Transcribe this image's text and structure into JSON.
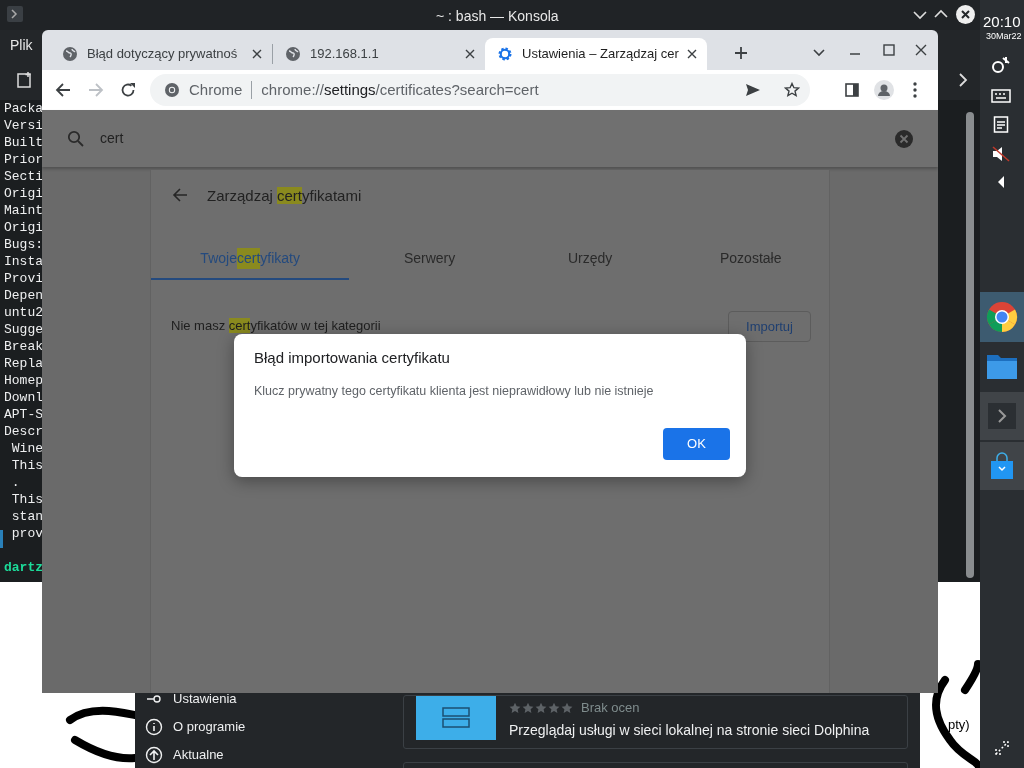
{
  "konsole": {
    "title": "~ : bash — Konsola",
    "menu": [
      "Plik"
    ],
    "terminal_lines": [
      "Packa",
      "Versi",
      "Built",
      "Prior",
      "Secti",
      "Origi",
      "Maint",
      "Origi",
      "Bugs:",
      "Insta",
      "Provi",
      "Depen",
      "untu2",
      "Sugge",
      "Break",
      "Repla",
      "Homep",
      "Downl",
      "APT-S",
      "Descr",
      " Wine",
      " This",
      " .",
      " This",
      " stan",
      " prov"
    ],
    "prompt": "dartz"
  },
  "panel": {
    "time": "20:10",
    "date": "30Mar22"
  },
  "discover": {
    "sidebar": [
      {
        "label": "Ustawienia"
      },
      {
        "label": "O programie"
      },
      {
        "label": "Aktualne"
      }
    ],
    "card": {
      "stars": 0,
      "rating_text": "Brak ocen",
      "description": "Przeglądaj usługi w sieci lokalnej na stronie sieci Dolphina"
    }
  },
  "desktop_text": "pty)",
  "browser": {
    "tabs": [
      {
        "title": "Błąd dotyczący prywatnoś",
        "selected": false
      },
      {
        "title": "192.168.1.1",
        "selected": false
      },
      {
        "title": "Ustawienia – Zarządzaj cer",
        "selected": true
      }
    ],
    "omnibox": {
      "chip": "Chrome",
      "url_parts": [
        {
          "text": "chrome://",
          "emphasized": false
        },
        {
          "text": "settings",
          "emphasized": true
        },
        {
          "text": "/certificates?search=cert",
          "emphasized": false
        }
      ]
    },
    "forward_disabled": true
  },
  "settings": {
    "search": "cert",
    "heading": [
      {
        "text": "Zarządzaj ",
        "highlighted": false
      },
      {
        "text": "cert",
        "highlighted": true
      },
      {
        "text": "yfikatami",
        "highlighted": false
      }
    ],
    "tabs": [
      {
        "parts": [
          {
            "text": "Twoje ",
            "highlighted": false
          },
          {
            "text": "cert",
            "highlighted": true
          },
          {
            "text": "yfikaty",
            "highlighted": false
          }
        ],
        "selected": true
      },
      {
        "parts": [
          {
            "text": "Serwery",
            "highlighted": false
          }
        ],
        "selected": false
      },
      {
        "parts": [
          {
            "text": "Urzędy",
            "highlighted": false
          }
        ],
        "selected": false
      },
      {
        "parts": [
          {
            "text": "Pozostałe",
            "highlighted": false
          }
        ],
        "selected": false
      }
    ],
    "empty_message": [
      {
        "text": "Nie masz ",
        "highlighted": false
      },
      {
        "text": "cert",
        "highlighted": true
      },
      {
        "text": "yfikatów w tej kategorii",
        "highlighted": false
      }
    ],
    "import_button": "Importuj"
  },
  "dialog": {
    "title": "Błąd importowania certyfikatu",
    "message": "Klucz prywatny tego certyfikatu klienta jest nieprawidłowy lub nie istnieje",
    "ok": "OK"
  }
}
